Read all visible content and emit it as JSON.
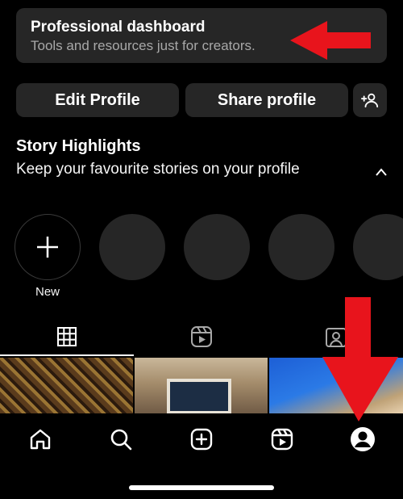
{
  "dashboard": {
    "title": "Professional dashboard",
    "subtitle": "Tools and resources just for creators."
  },
  "buttons": {
    "edit_profile": "Edit Profile",
    "share_profile": "Share profile",
    "add_person_icon": "person-add-icon"
  },
  "highlights": {
    "title": "Story Highlights",
    "subtitle": "Keep your favourite stories on your profile",
    "new_label": "New",
    "empty_slots": 4
  },
  "tabs": [
    {
      "icon": "grid-icon",
      "selected": true
    },
    {
      "icon": "reels-icon",
      "selected": false
    },
    {
      "icon": "tagged-icon",
      "selected": false
    }
  ],
  "nav": [
    {
      "icon": "home-icon"
    },
    {
      "icon": "search-icon"
    },
    {
      "icon": "create-icon"
    },
    {
      "icon": "reels-icon"
    },
    {
      "icon": "profile-icon",
      "selected": true
    }
  ],
  "colors": {
    "background": "#000000",
    "card": "#262626",
    "secondary_text": "#a8a8a8",
    "annotation_arrow": "#e8141c"
  }
}
